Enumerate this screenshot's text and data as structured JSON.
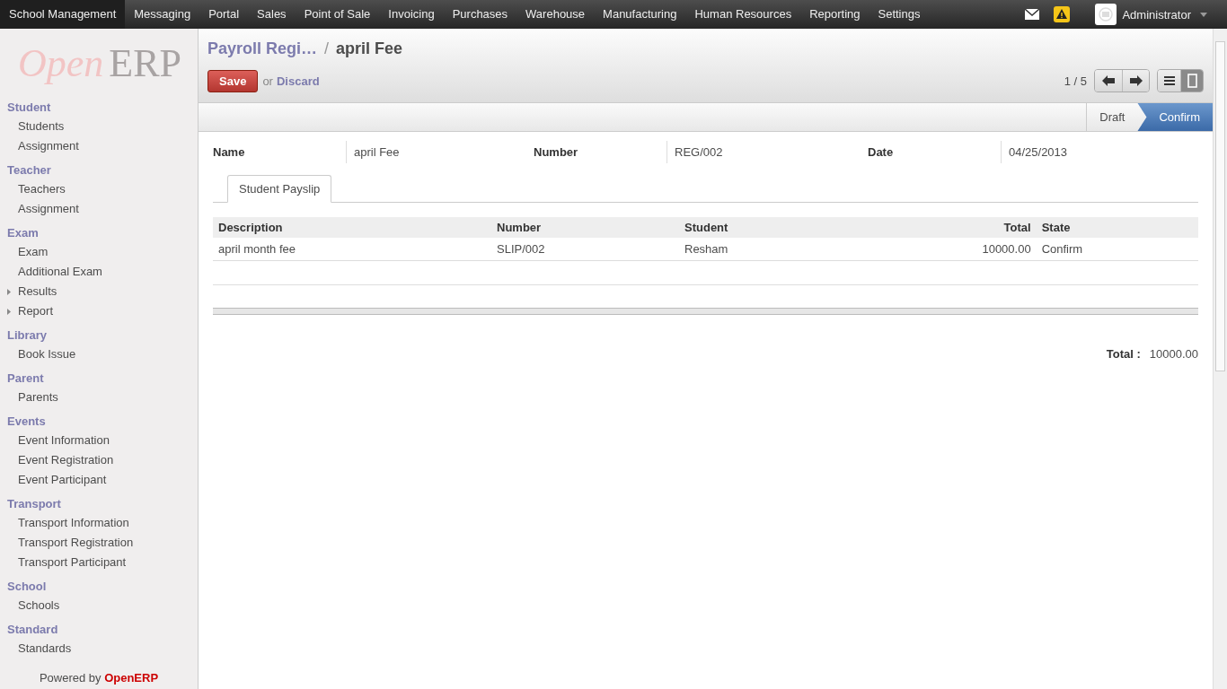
{
  "top_menu": [
    {
      "label": "School Management",
      "selected": true
    },
    {
      "label": "Messaging",
      "selected": false
    },
    {
      "label": "Portal",
      "selected": false
    },
    {
      "label": "Sales",
      "selected": false
    },
    {
      "label": "Point of Sale",
      "selected": false
    },
    {
      "label": "Invoicing",
      "selected": false
    },
    {
      "label": "Purchases",
      "selected": false
    },
    {
      "label": "Warehouse",
      "selected": false
    },
    {
      "label": "Manufacturing",
      "selected": false
    },
    {
      "label": "Human Resources",
      "selected": false
    },
    {
      "label": "Reporting",
      "selected": false
    },
    {
      "label": "Settings",
      "selected": false
    }
  ],
  "user": {
    "name": "Administrator"
  },
  "logo": {
    "part1": "Open",
    "part2": "ERP"
  },
  "sidebar": [
    {
      "title": "Student",
      "items": [
        {
          "label": "Students",
          "kind": "leaf"
        },
        {
          "label": "Assignment",
          "kind": "leaf"
        }
      ]
    },
    {
      "title": "Teacher",
      "items": [
        {
          "label": "Teachers",
          "kind": "leaf"
        },
        {
          "label": "Assignment",
          "kind": "leaf"
        }
      ]
    },
    {
      "title": "Exam",
      "items": [
        {
          "label": "Exam",
          "kind": "leaf"
        },
        {
          "label": "Additional Exam",
          "kind": "leaf"
        },
        {
          "label": "Results",
          "kind": "folder"
        },
        {
          "label": "Report",
          "kind": "folder"
        }
      ]
    },
    {
      "title": "Library",
      "items": [
        {
          "label": "Book Issue",
          "kind": "leaf"
        }
      ]
    },
    {
      "title": "Parent",
      "items": [
        {
          "label": "Parents",
          "kind": "leaf"
        }
      ]
    },
    {
      "title": "Events",
      "items": [
        {
          "label": "Event Information",
          "kind": "leaf"
        },
        {
          "label": "Event Registration",
          "kind": "leaf"
        },
        {
          "label": "Event Participant",
          "kind": "leaf"
        }
      ]
    },
    {
      "title": "Transport",
      "items": [
        {
          "label": "Transport Information",
          "kind": "leaf"
        },
        {
          "label": "Transport Registration",
          "kind": "leaf"
        },
        {
          "label": "Transport Participant",
          "kind": "leaf"
        }
      ]
    },
    {
      "title": "School",
      "items": [
        {
          "label": "Schools",
          "kind": "leaf"
        }
      ]
    },
    {
      "title": "Standard",
      "items": [
        {
          "label": "Standards",
          "kind": "leaf"
        }
      ]
    }
  ],
  "powered_by": {
    "text": "Powered by",
    "brand": "OpenERP"
  },
  "breadcrumb": {
    "parent": "Payroll Regi…",
    "separator": "/",
    "current": "april Fee"
  },
  "actions": {
    "save": "Save",
    "or": "or",
    "discard": "Discard"
  },
  "pager": {
    "text": "1 / 5"
  },
  "views": [
    {
      "kind": "list",
      "selected": false
    },
    {
      "kind": "form",
      "selected": true
    }
  ],
  "status_bar": [
    {
      "label": "Draft",
      "selected": false
    },
    {
      "label": "Confirm",
      "selected": true
    }
  ],
  "fields": [
    {
      "label": "Name",
      "value": "april Fee"
    },
    {
      "label": "Number",
      "value": "REG/002"
    },
    {
      "label": "Date",
      "value": "04/25/2013"
    }
  ],
  "tabs": [
    {
      "label": "Student Payslip",
      "selected": true
    }
  ],
  "table": {
    "columns": [
      "Description",
      "Number",
      "Student",
      "Total",
      "State"
    ],
    "rows": [
      [
        "april month fee",
        "SLIP/002",
        "Resham",
        "10000.00",
        "Confirm"
      ]
    ]
  },
  "total": {
    "label": "Total :",
    "value": "10000.00"
  }
}
